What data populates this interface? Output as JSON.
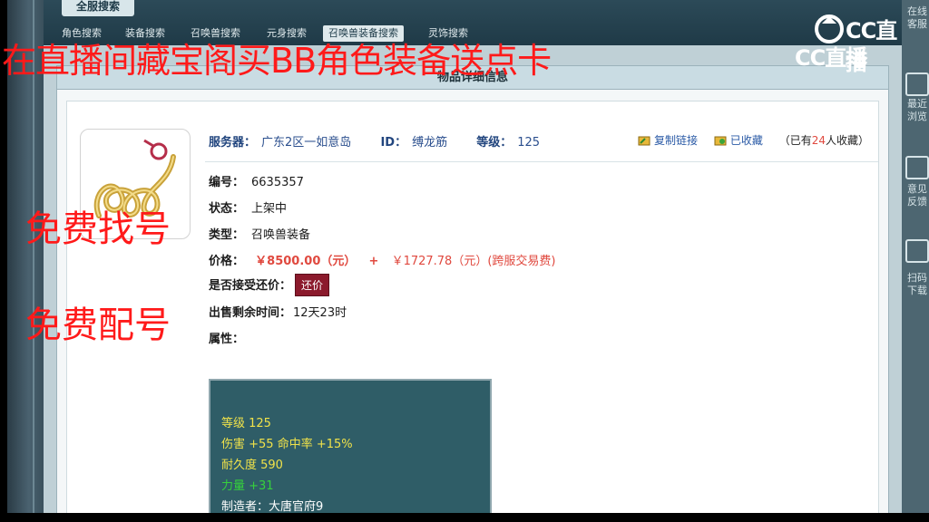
{
  "nav": {
    "main_tab": "全服搜索",
    "subtabs": [
      "角色搜索",
      "装备搜索",
      "召唤兽搜索",
      "元身搜索",
      "召唤兽装备搜索",
      "灵饰搜索"
    ],
    "active_subtab_index": 4
  },
  "panel": {
    "title": "物品详细信息"
  },
  "item": {
    "server_label": "服务器：",
    "server": "广东2区一如意岛",
    "id_label": "ID：",
    "id": "缚龙筋",
    "level_label": "等级：",
    "level": "125",
    "copy_link": "复制链接",
    "favorited": "已收藏",
    "fav_count_prefix": "（已有",
    "fav_count": "24",
    "fav_count_suffix": "人收藏）",
    "serial_label": "编号：",
    "serial": "6635357",
    "status_label": "状态：",
    "status": "上架中",
    "type_label": "类型：",
    "type": "召唤兽装备",
    "price_label": "价格：",
    "price": "￥8500.00（元）",
    "plus": "+",
    "fee": "￥1727.78（元）(跨服交易费)",
    "haggle_label": "是否接受还价：",
    "haggle_button": "还价",
    "remain_label": "出售剩余时间：",
    "remain": "12天23时",
    "attr_label": "属性："
  },
  "attributes": {
    "line1": "等级 125",
    "line2": "伤害 +55 命中率 +15%",
    "line3": "耐久度 590",
    "line4": "力量 +31",
    "line5": "制造者：大唐官府9"
  },
  "right_sidebar": [
    "在线客服",
    "最近浏览",
    "意见反馈",
    "扫码下载"
  ],
  "overlay": {
    "banner": "在直播间藏宝阁买BB角色装备送点卡",
    "line1": "免费找号",
    "line2": "免费配号"
  },
  "watermark": {
    "text1": "CC直播",
    "text2": "CC直播"
  },
  "colors": {
    "accent_red": "#ff1a1a",
    "price": "#e0493f",
    "attr_bg": "#2f5d67"
  }
}
